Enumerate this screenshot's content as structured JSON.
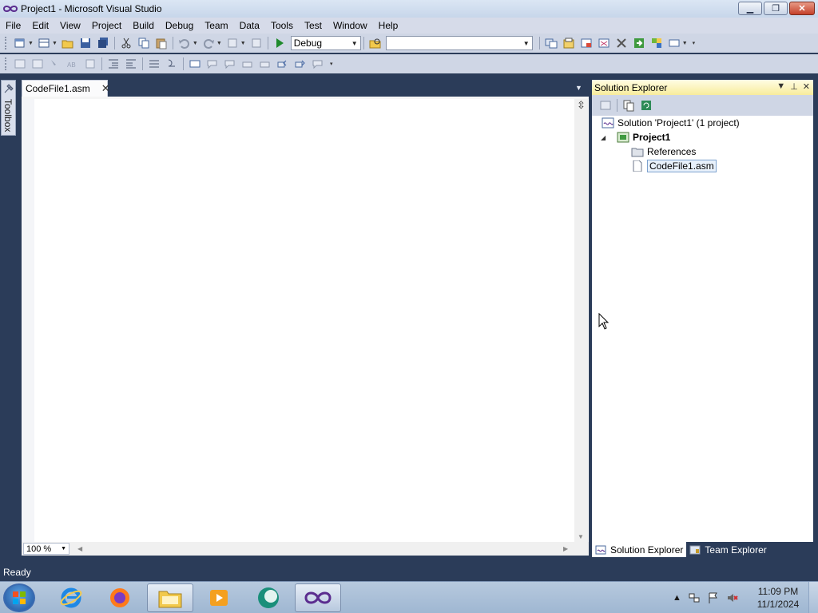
{
  "window": {
    "title": "Project1 - Microsoft Visual Studio",
    "minimize_icon": "minimize-icon",
    "restore_icon": "restore-icon",
    "close_icon": "close-icon"
  },
  "menu": {
    "items": [
      "File",
      "Edit",
      "View",
      "Project",
      "Build",
      "Debug",
      "Team",
      "Data",
      "Tools",
      "Test",
      "Window",
      "Help"
    ]
  },
  "toolbar": {
    "config_value": "Debug",
    "platform_value": ""
  },
  "toolbox": {
    "label": "Toolbox"
  },
  "editor": {
    "tab_label": "CodeFile1.asm",
    "zoom_value": "100 %"
  },
  "solution_explorer": {
    "title": "Solution Explorer",
    "tree": {
      "solution": "Solution 'Project1' (1 project)",
      "project": "Project1",
      "references": "References",
      "file": "CodeFile1.asm"
    },
    "bottom_tabs": [
      "Solution Explorer",
      "Team Explorer"
    ]
  },
  "status": {
    "text": "Ready"
  },
  "taskbar": {
    "time": "11:09 PM",
    "date": "11/1/2024"
  },
  "colors": {
    "chrome_dark": "#2b3c59",
    "toolbar": "#cfd6e5",
    "panel_header": "#f8ec9c",
    "selection": "#e8f1fb"
  }
}
